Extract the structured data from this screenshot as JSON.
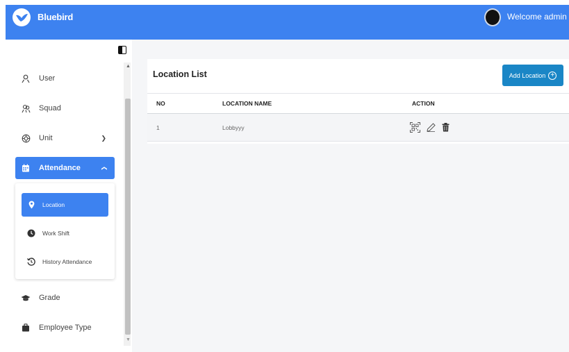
{
  "header": {
    "brand": "Bluebird",
    "welcome": "Welcome admin"
  },
  "sidebar": {
    "items": [
      {
        "label": "User",
        "icon": "user-icon"
      },
      {
        "label": "Squad",
        "icon": "users-icon"
      },
      {
        "label": "Unit",
        "icon": "unit-icon"
      },
      {
        "label": "Attendance",
        "icon": "calendar-icon"
      },
      {
        "label": "Grade",
        "icon": "graduation-cap-icon"
      },
      {
        "label": "Employee Type",
        "icon": "briefcase-icon"
      }
    ],
    "attendance_sub": [
      {
        "label": "Location",
        "icon": "map-pin-icon"
      },
      {
        "label": "Work Shift",
        "icon": "clock-icon"
      },
      {
        "label": "History Attendance",
        "icon": "history-icon"
      }
    ]
  },
  "main": {
    "title": "Location List",
    "add_button": "Add Location",
    "table": {
      "columns": [
        "NO",
        "LOCATION NAME",
        "ACTION"
      ],
      "rows": [
        {
          "no": "1",
          "name": "Lobbyyy"
        }
      ]
    }
  },
  "colors": {
    "primary": "#3d82f0",
    "button": "#1a86c6",
    "background": "#f5f6f8"
  }
}
